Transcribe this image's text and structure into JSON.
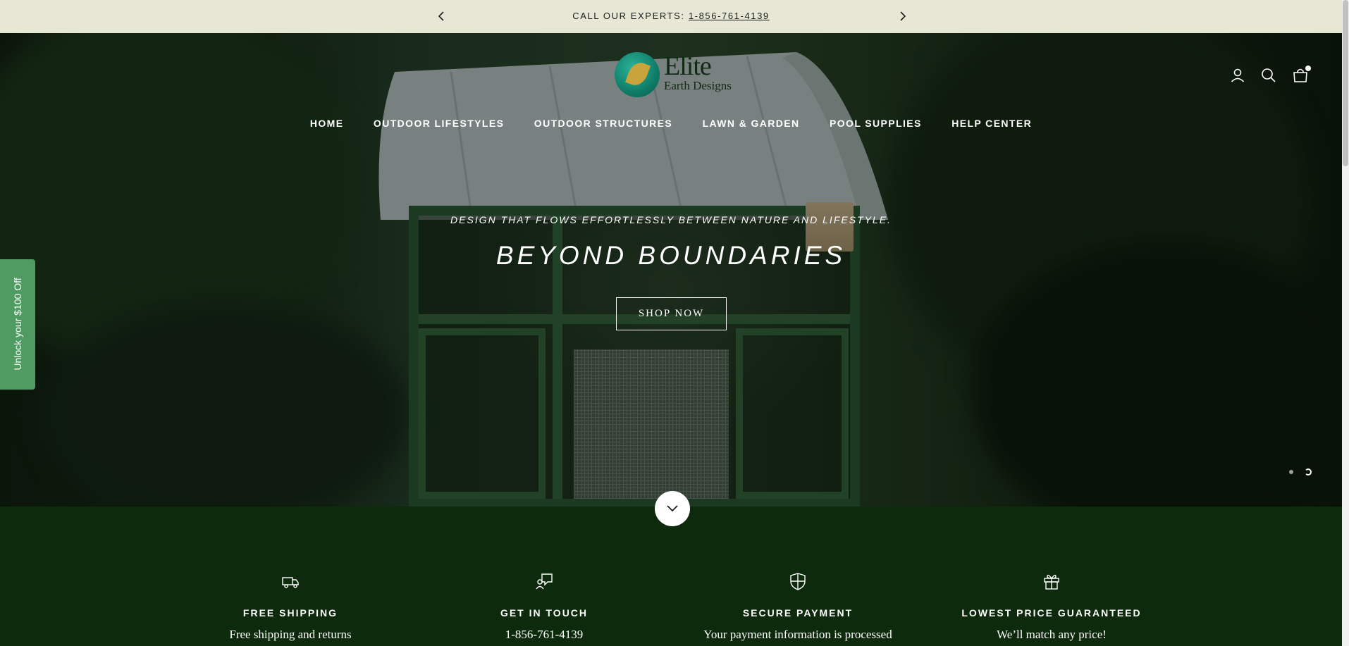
{
  "announcement": {
    "prefix": "CALL OUR EXPERTS: ",
    "phone": "1-856-761-4139"
  },
  "logo": {
    "name": "Elite",
    "subtitle": "Earth Designs"
  },
  "nav": {
    "items": [
      "HOME",
      "OUTDOOR LIFESTYLES",
      "OUTDOOR STRUCTURES",
      "LAWN & GARDEN",
      "POOL SUPPLIES",
      "HELP CENTER"
    ]
  },
  "header_icons": [
    "account-icon",
    "search-icon",
    "cart-icon"
  ],
  "hero": {
    "tagline": "DESIGN THAT FLOWS EFFORTLESSLY BETWEEN NATURE AND LIFESTYLE.",
    "headline": "BEYOND BOUNDARIES",
    "cta": "SHOP NOW",
    "slide_count": 2,
    "active_slide": 2
  },
  "side_tab": {
    "label": "Unlock your $100 Off"
  },
  "features": [
    {
      "icon": "truck-icon",
      "title": "FREE SHIPPING",
      "description": "Free shipping and returns"
    },
    {
      "icon": "chat-icon",
      "title": "GET IN TOUCH",
      "description": "1-856-761-4139"
    },
    {
      "icon": "shield-icon",
      "title": "SECURE PAYMENT",
      "description": "Your payment information is processed"
    },
    {
      "icon": "gift-icon",
      "title": "LOWEST PRICE GUARANTEED",
      "description": "We’ll match any price!"
    }
  ],
  "colors": {
    "announcement_bg": "#e6e8d5",
    "features_bg": "#0d2a0c",
    "side_tab_bg": "#4f9b61",
    "logo_teal": "#0f7d68"
  }
}
